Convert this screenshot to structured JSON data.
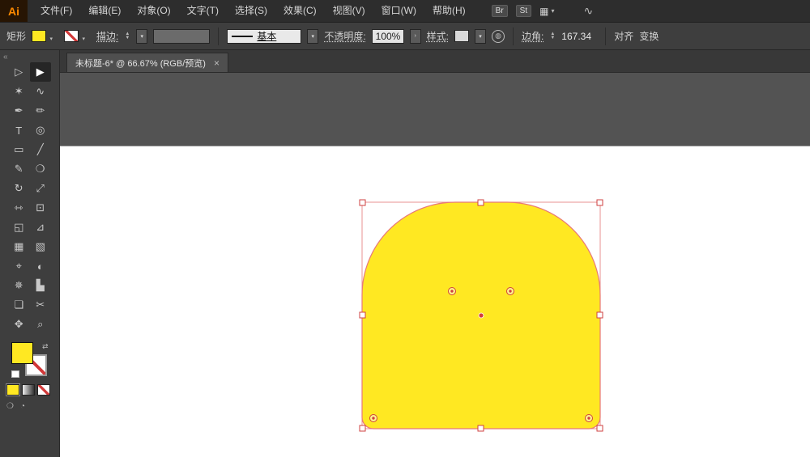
{
  "colors": {
    "shape_fill": "#ffe822",
    "selection": "#e06060",
    "handle_stroke": "#cf4040",
    "accent_yellow": "#ffe822"
  },
  "menubar": {
    "logo": "Ai",
    "items": [
      {
        "name": "file",
        "label": "文件(F)"
      },
      {
        "name": "edit",
        "label": "编辑(E)"
      },
      {
        "name": "object",
        "label": "对象(O)"
      },
      {
        "name": "type",
        "label": "文字(T)"
      },
      {
        "name": "select",
        "label": "选择(S)"
      },
      {
        "name": "effect",
        "label": "效果(C)"
      },
      {
        "name": "view",
        "label": "视图(V)"
      },
      {
        "name": "window",
        "label": "窗口(W)"
      },
      {
        "name": "help",
        "label": "帮助(H)"
      }
    ],
    "bridge_badge": "Br",
    "stock_badge": "St",
    "workspace_icon": "▦",
    "workspace_chevron": "▾",
    "swirl_icon": "∿"
  },
  "controlbar": {
    "shape_type": "矩形",
    "fill_chevron": "▾",
    "stroke_chevron": "▾",
    "stroke_label": "描边:",
    "stepper_up": "▲",
    "stepper_down": "▼",
    "weight_chevron": "▾",
    "stroke_style_label": "基本",
    "style_chevron": "▾",
    "opacity_label": "不透明度:",
    "opacity_value": "100%",
    "opacity_more": "›",
    "style_label": "样式:",
    "globe_icon": "◍",
    "corner_label": "边角:",
    "corner_value": "167.34",
    "align_label": "对齐",
    "transform_label": "变换"
  },
  "tabbar": {
    "collapse": "«",
    "tab_title": "未标题-6* @ 66.67% (RGB/预览)",
    "close": "×"
  },
  "toolbar": {
    "tools": [
      {
        "name": "direct-selection-tool",
        "glyph": "▷"
      },
      {
        "name": "selection-tool",
        "glyph": "▶",
        "active": true
      },
      {
        "name": "magic-wand-tool",
        "glyph": "✶"
      },
      {
        "name": "lasso-tool",
        "glyph": "∿"
      },
      {
        "name": "pen-tool",
        "glyph": "✒"
      },
      {
        "name": "brush-tool",
        "glyph": "✏"
      },
      {
        "name": "type-tool",
        "glyph": "T"
      },
      {
        "name": "twirl-tool",
        "glyph": "◎"
      },
      {
        "name": "rectangle-tool",
        "glyph": "▭"
      },
      {
        "name": "line-tool",
        "glyph": "╱"
      },
      {
        "name": "pencil-tool",
        "glyph": "✎"
      },
      {
        "name": "blob-brush-tool",
        "glyph": "❍"
      },
      {
        "name": "rotate-tool",
        "glyph": "↻"
      },
      {
        "name": "scale-tool",
        "glyph": "⤢"
      },
      {
        "name": "width-tool",
        "glyph": "⇿"
      },
      {
        "name": "free-transform-tool",
        "glyph": "⊡"
      },
      {
        "name": "shape-builder-tool",
        "glyph": "◱"
      },
      {
        "name": "perspective-grid-tool",
        "glyph": "⊿"
      },
      {
        "name": "mesh-tool",
        "glyph": "▦"
      },
      {
        "name": "gradient-tool",
        "glyph": "▧"
      },
      {
        "name": "eyedropper-tool",
        "glyph": "⌖"
      },
      {
        "name": "blend-tool",
        "glyph": "◐"
      },
      {
        "name": "symbol-sprayer-tool",
        "glyph": "✵"
      },
      {
        "name": "graph-tool",
        "glyph": "▙"
      },
      {
        "name": "artboard-tool",
        "glyph": "❏"
      },
      {
        "name": "slice-tool",
        "glyph": "✂"
      },
      {
        "name": "hand-tool",
        "glyph": "✥"
      },
      {
        "name": "zoom-tool",
        "glyph": "⌕"
      }
    ]
  }
}
